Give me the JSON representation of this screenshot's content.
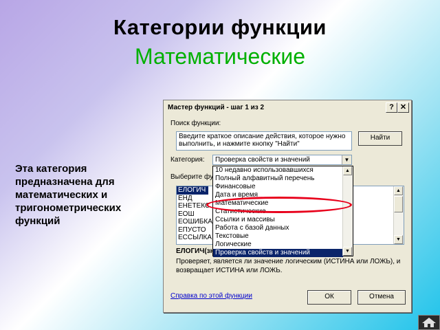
{
  "slide": {
    "title": "Категории функции",
    "subtitle": "Математические",
    "side_text": "Эта категория предназначена для математических и тригонометрических функций"
  },
  "dialog": {
    "title": "Мастер функций - шаг 1 из 2",
    "help_btn": "?",
    "close_btn": "✕",
    "search_label": "Поиск функции:",
    "search_text": "Введите краткое описание действия, которое нужно выполнить, и нажмите кнопку \"Найти\"",
    "find_button": "Найти",
    "category_label": "Категория:",
    "category_value": "Проверка свойств и значений",
    "select_label": "Выберите фу",
    "functions": [
      "ЕЛОГИЧ",
      "ЕНД",
      "ЕНЕТЕКС",
      "ЕОШ",
      "ЕОШИБКА",
      "ЕПУСТО",
      "ЕССЫЛКА"
    ],
    "desc_title": "ЕЛОГИЧ(зн",
    "desc_text": "Проверяет, является ли значение логическим (ИСТИНА или ЛОЖЬ), и возвращает ИСТИНА или ЛОЖЬ.",
    "help_link": "Справка по этой функции",
    "ok_button": "ОК",
    "cancel_button": "Отмена"
  },
  "dropdown": {
    "options": [
      "10 недавно использовавшихся",
      "Полный алфавитный перечень",
      "Финансовые",
      "Дата и время",
      "Математические",
      "Статистические",
      "Ссылки и массивы",
      "Работа с базой данных",
      "Текстовые",
      "Логические",
      "Проверка свойств и значений"
    ],
    "selected_index": 10
  },
  "colors": {
    "title": "#000000",
    "subtitle": "#00b000",
    "highlight": "#e8001b",
    "selection": "#0a246a"
  },
  "icons": {
    "nav": "home-house-icon"
  }
}
